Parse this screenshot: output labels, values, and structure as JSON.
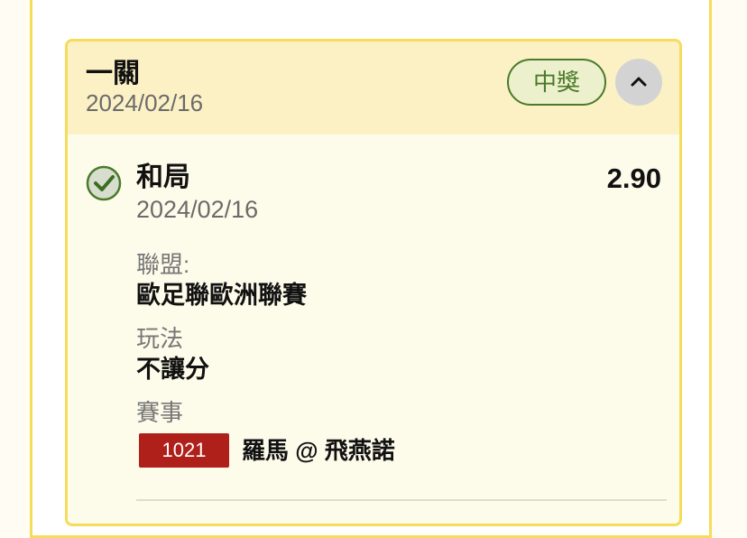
{
  "bet": {
    "type": "一關",
    "date": "2024/02/16",
    "status": "中獎",
    "selection": {
      "name": "和局",
      "date": "2024/02/16",
      "odds": "2.90",
      "league_label": "聯盟:",
      "league_value": "歐足聯歐洲聯賽",
      "pool_label": "玩法",
      "pool_value": "不讓分",
      "match_label": "賽事",
      "match_number": "1021",
      "match_name": "羅馬 @ 飛燕諾"
    }
  },
  "icons": {
    "collapse": "chevron-up-icon",
    "result": "check-circle-icon"
  },
  "colors": {
    "accent_border": "#f5dc5a",
    "header_bg": "#fcf1c5",
    "win_green": "#4a7a2a",
    "match_badge": "#b0201a"
  }
}
